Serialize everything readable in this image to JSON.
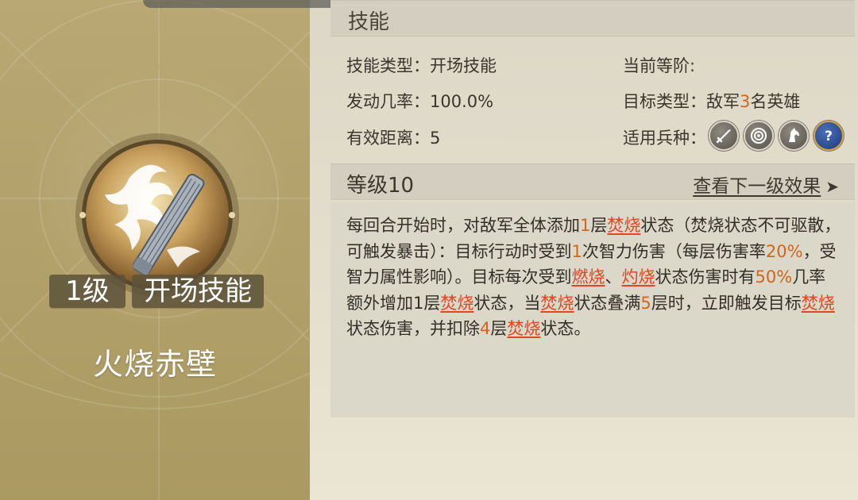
{
  "card": {
    "level_tag": "1级",
    "type_tag": "开场技能",
    "skill_name": "火烧赤壁"
  },
  "skill_section": {
    "title": "技能",
    "type_label": "技能类型：",
    "type_value": "开场技能",
    "rank_label": "当前等阶:",
    "rate_label": "发动几率：",
    "rate_value": "100.0%",
    "target_label": "目标类型：",
    "target_prefix": "敌军",
    "target_count": "3",
    "target_suffix": "名英雄",
    "range_label": "有效距离：",
    "range_value": "5",
    "troop_label": "适用兵种：",
    "troop_icons": [
      "sword-infantry-icon",
      "bow-archer-icon",
      "horse-cavalry-icon",
      "question-unknown-icon"
    ]
  },
  "level_section": {
    "title": "等级10",
    "next_link": "查看下一级效果",
    "arrow": "➤"
  },
  "description": {
    "p1": "每回合开始时，对敌军全体添加",
    "n1": "1",
    "p2": "层",
    "k1": "焚烧",
    "p3": "状态（焚烧状态不可驱散，可触发暴击）：目标行动时受到",
    "n2": "1",
    "p4": "次智力伤害（每层伤害率",
    "n3": "20%",
    "p5": "，受智力属性影响）。目标每次受到",
    "k2": "燃烧",
    "p6": "、",
    "k3": "灼烧",
    "p7": "状态伤害时有",
    "n4": "50%",
    "p8": "几率额外增加1层",
    "k4": "焚烧",
    "p9": "状态，当",
    "k5": "焚烧",
    "p10": "状态叠满",
    "n5": "5",
    "p11": "层时，立即触发目标",
    "k6": "焚烧",
    "p12": "状态伤害，并扣除",
    "n6": "4",
    "p13": "层",
    "k7": "焚烧",
    "p14": "状态。"
  },
  "colors": {
    "card_bg": "#b5a46e",
    "keyword": "#e0461f",
    "number": "#d1661c",
    "header_bg": "#d3cebf"
  }
}
